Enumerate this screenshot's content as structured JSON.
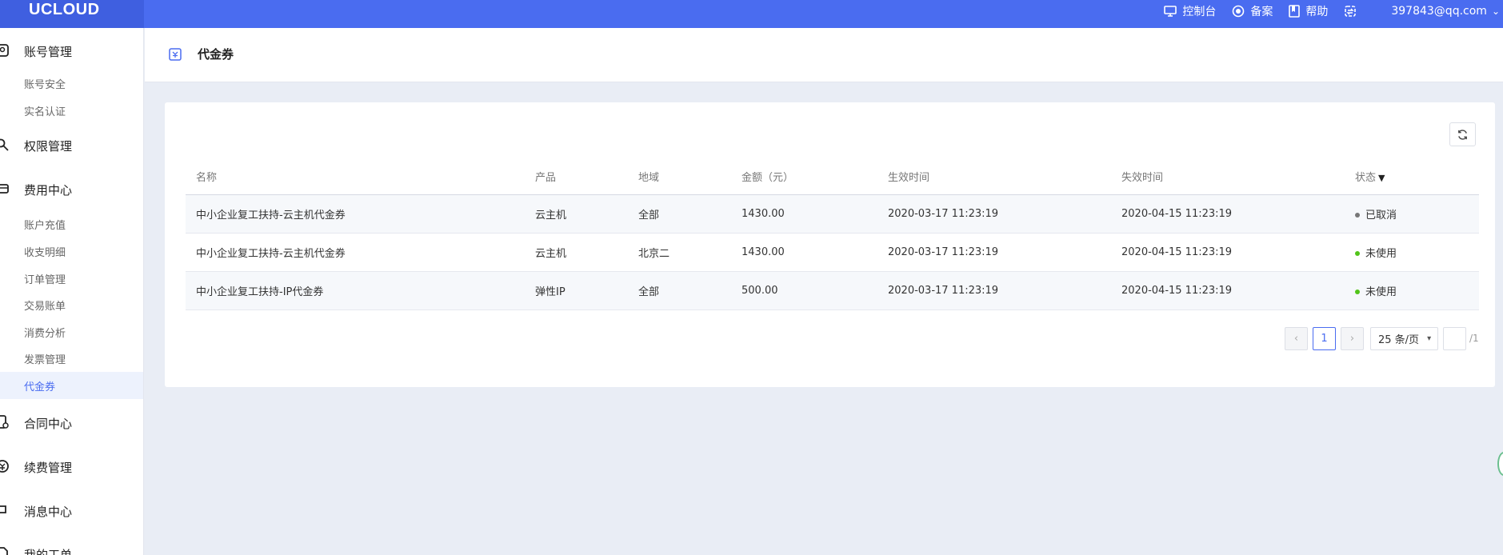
{
  "topbar": {
    "logo": "UCLOUD",
    "nav": [
      {
        "label": "控制台",
        "icon": "monitor-icon"
      },
      {
        "label": "备案",
        "icon": "record-icon"
      },
      {
        "label": "帮助",
        "icon": "book-icon"
      },
      {
        "label": "",
        "icon": "transfer-icon"
      }
    ],
    "user_email": "397843@qq.com"
  },
  "sidebar": {
    "groups": [
      {
        "label": "账号管理",
        "icon": "account-icon",
        "items": [
          "账号安全",
          "实名认证"
        ]
      },
      {
        "label": "权限管理",
        "icon": "key-icon",
        "items": []
      },
      {
        "label": "费用中心",
        "icon": "wallet-icon",
        "items": [
          "账户充值",
          "收支明细",
          "订单管理",
          "交易账单",
          "消费分析",
          "发票管理",
          "代金券"
        ]
      },
      {
        "label": "合同中心",
        "icon": "contract-icon",
        "items": []
      },
      {
        "label": "续费管理",
        "icon": "renew-icon",
        "items": []
      },
      {
        "label": "消息中心",
        "icon": "message-icon",
        "items": []
      },
      {
        "label": "我的工单",
        "icon": "ticket-icon",
        "items": []
      }
    ],
    "active_item": "代金券"
  },
  "page": {
    "title": "代金券",
    "title_icon": "voucher-icon"
  },
  "table": {
    "columns": [
      "名称",
      "产品",
      "地域",
      "金额（元）",
      "生效时间",
      "失效时间",
      "状态"
    ],
    "rows": [
      {
        "name": "中小企业复工扶持-云主机代金券",
        "product": "云主机",
        "region": "全部",
        "amount": "1430.00",
        "start": "2020-03-17 11:23:19",
        "end": "2020-04-15 11:23:19",
        "status": "已取消",
        "status_color": "#777777"
      },
      {
        "name": "中小企业复工扶持-云主机代金券",
        "product": "云主机",
        "region": "北京二",
        "amount": "1430.00",
        "start": "2020-03-17 11:23:19",
        "end": "2020-04-15 11:23:19",
        "status": "未使用",
        "status_color": "#52c41a"
      },
      {
        "name": "中小企业复工扶持-IP代金券",
        "product": "弹性IP",
        "region": "全部",
        "amount": "500.00",
        "start": "2020-03-17 11:23:19",
        "end": "2020-04-15 11:23:19",
        "status": "未使用",
        "status_color": "#52c41a"
      }
    ]
  },
  "pagination": {
    "prev": "‹",
    "current": "1",
    "next": "›",
    "page_size": "25 条/页",
    "jump_value": "",
    "total": "/1"
  },
  "colors": {
    "brand": "#4a6cf0",
    "active_bg": "#edf2fd"
  }
}
